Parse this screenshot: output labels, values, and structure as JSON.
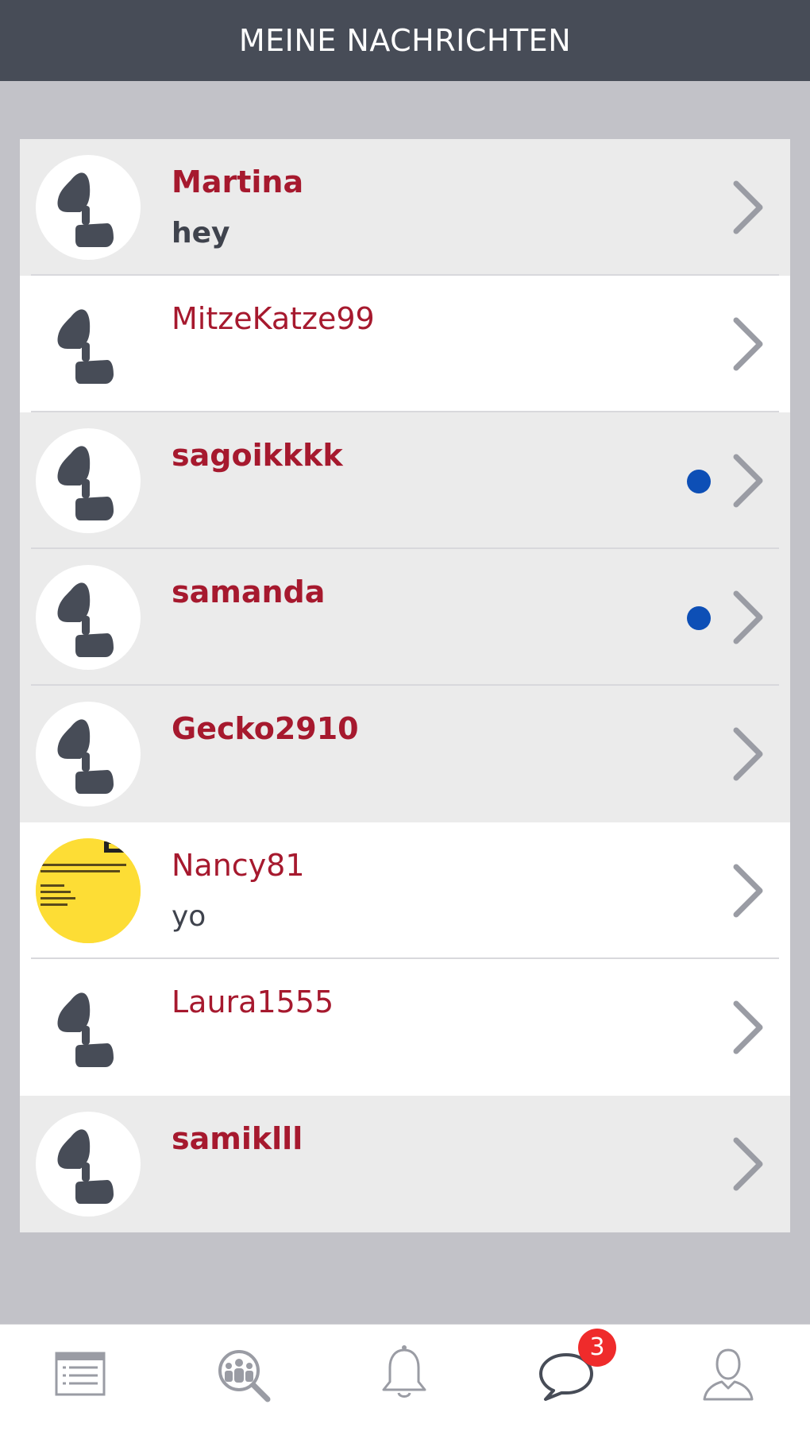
{
  "header": {
    "title": "MEINE NACHRICHTEN"
  },
  "conversations": [
    {
      "name": "Martina",
      "preview": "hey",
      "unread": true,
      "new_indicator": false,
      "avatar": "placeholder"
    },
    {
      "name": "MitzeKatze99",
      "preview": "",
      "unread": false,
      "new_indicator": false,
      "avatar": "placeholder"
    },
    {
      "name": "sagoikkkk",
      "preview": "",
      "unread": true,
      "new_indicator": true,
      "avatar": "placeholder"
    },
    {
      "name": "samanda",
      "preview": "",
      "unread": true,
      "new_indicator": true,
      "avatar": "placeholder"
    },
    {
      "name": "Gecko2910",
      "preview": "",
      "unread": true,
      "new_indicator": false,
      "avatar": "placeholder"
    },
    {
      "name": "Nancy81",
      "preview": "yo",
      "unread": false,
      "new_indicator": false,
      "avatar": "photo"
    },
    {
      "name": "Laura1555",
      "preview": "",
      "unread": false,
      "new_indicator": false,
      "avatar": "placeholder"
    },
    {
      "name": "samiklll",
      "preview": "",
      "unread": true,
      "new_indicator": false,
      "avatar": "placeholder"
    }
  ],
  "tabbar": {
    "tabs": [
      {
        "icon": "newsfeed-icon"
      },
      {
        "icon": "people-search-icon"
      },
      {
        "icon": "bell-icon"
      },
      {
        "icon": "chat-bubble-icon",
        "active": true,
        "badge": "3"
      },
      {
        "icon": "profile-icon"
      }
    ]
  },
  "colors": {
    "header_bg": "#474c57",
    "name_red": "#a6192e",
    "dot_blue": "#0d4fb6",
    "badge_red": "#ef2b2b",
    "page_bg": "#c2c2c8"
  }
}
